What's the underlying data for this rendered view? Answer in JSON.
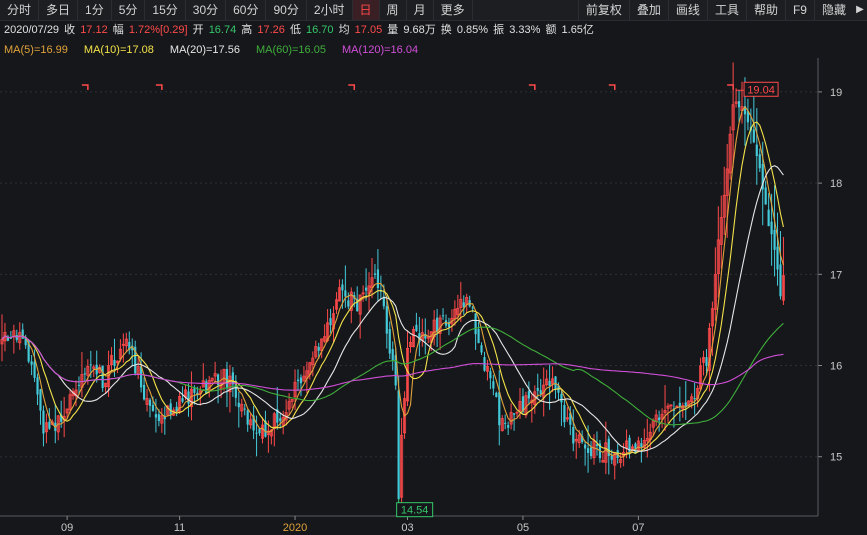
{
  "toolbar": {
    "periods": [
      "分时",
      "多日",
      "1分",
      "5分",
      "15分",
      "30分",
      "60分",
      "90分",
      "2小时",
      "日",
      "周",
      "月",
      "更多"
    ],
    "active_period": "日",
    "tools": [
      "前复权",
      "叠加",
      "画线",
      "工具",
      "帮助",
      "F9",
      "隐藏"
    ],
    "arrow": "▶"
  },
  "quote": {
    "date": "2020/07/29",
    "close_label": "收",
    "close": "17.12",
    "change_label": "幅",
    "change": "1.72%[0.29]",
    "open_label": "开",
    "open": "16.74",
    "high_label": "高",
    "high": "17.26",
    "low_label": "低",
    "low": "16.70",
    "avg_label": "均",
    "avg": "17.05",
    "volume_label": "量",
    "volume": "9.68万",
    "turnover_label": "换",
    "turnover": "0.85%",
    "amplitude_label": "振",
    "amplitude": "3.33%",
    "amount_label": "额",
    "amount": "1.65亿"
  },
  "ma_legend": [
    {
      "text": "MA(5)=16.99",
      "color": "#e0a23a"
    },
    {
      "text": "MA(10)=17.08",
      "color": "#f3e24a"
    },
    {
      "text": "MA(20)=17.56",
      "color": "#e6e6e6"
    },
    {
      "text": "MA(60)=16.05",
      "color": "#3fae3a"
    },
    {
      "text": "MA(120)=16.04",
      "color": "#d14fd8"
    }
  ],
  "colors": {
    "up": "#ff4a4a",
    "down": "#43c9d8",
    "background": "#16171b",
    "grid": "#2d2f36",
    "axis_text": "#c8c8c8"
  },
  "chart_data": {
    "type": "candlestick",
    "x_ticks": [
      "09",
      "11",
      "2020",
      "03",
      "05",
      "07"
    ],
    "x_tick_index": [
      22,
      60,
      99,
      137,
      176,
      215
    ],
    "y_ticks": [
      15,
      16,
      17,
      18,
      19
    ],
    "ylim": [
      14.35,
      19.35
    ],
    "n": 265,
    "max_label": "19.04",
    "max_index": 248,
    "min_label": "14.54",
    "min_index": 134,
    "anchors": [
      [
        0,
        16.38
      ],
      [
        8,
        16.32
      ],
      [
        14,
        15.28
      ],
      [
        20,
        15.4
      ],
      [
        28,
        16.0
      ],
      [
        34,
        15.85
      ],
      [
        42,
        16.3
      ],
      [
        48,
        15.7
      ],
      [
        54,
        15.38
      ],
      [
        60,
        15.62
      ],
      [
        68,
        15.75
      ],
      [
        75,
        15.92
      ],
      [
        82,
        15.45
      ],
      [
        90,
        15.25
      ],
      [
        98,
        15.7
      ],
      [
        108,
        16.2
      ],
      [
        114,
        16.78
      ],
      [
        120,
        16.7
      ],
      [
        127,
        16.95
      ],
      [
        133,
        15.85
      ],
      [
        134,
        14.62
      ],
      [
        137,
        16.25
      ],
      [
        145,
        16.42
      ],
      [
        152,
        16.5
      ],
      [
        157,
        16.78
      ],
      [
        163,
        16.05
      ],
      [
        168,
        15.42
      ],
      [
        172,
        15.42
      ],
      [
        180,
        15.75
      ],
      [
        186,
        15.85
      ],
      [
        192,
        15.25
      ],
      [
        198,
        15.1
      ],
      [
        206,
        15.05
      ],
      [
        214,
        15.1
      ],
      [
        222,
        15.45
      ],
      [
        228,
        15.55
      ],
      [
        234,
        15.7
      ],
      [
        238,
        16.1
      ],
      [
        244,
        17.9
      ],
      [
        246,
        18.6
      ],
      [
        248,
        18.9
      ],
      [
        252,
        18.6
      ],
      [
        256,
        18.1
      ],
      [
        260,
        17.4
      ],
      [
        263,
        16.85
      ],
      [
        265,
        17.12
      ]
    ],
    "ma_periods": [
      5,
      10,
      20,
      60,
      120
    ],
    "gap_markers": [
      28,
      53,
      118,
      179,
      206,
      246
    ]
  }
}
